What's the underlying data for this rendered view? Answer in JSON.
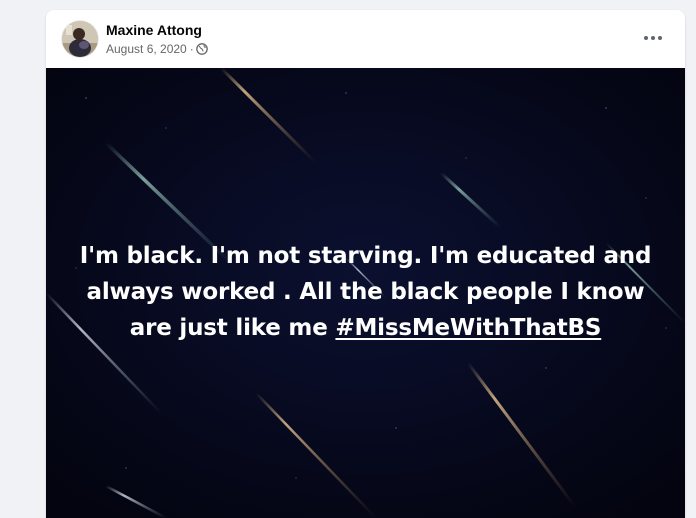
{
  "post": {
    "author": "Maxine Attong",
    "date": "August 6, 2020",
    "separator": "·",
    "privacy_icon": "globe-icon",
    "options_icon": "more-options-icon",
    "text_main": "I'm black. I'm not starving. I'm educated and always worked . All the black people I know are just like me ",
    "hashtag": "#MissMeWithThatBS",
    "background": "dark starry sky with meteor streaks",
    "colors": {
      "text": "#ffffff",
      "background": "#05071a",
      "name": "#050505",
      "meta": "#65676b"
    }
  }
}
